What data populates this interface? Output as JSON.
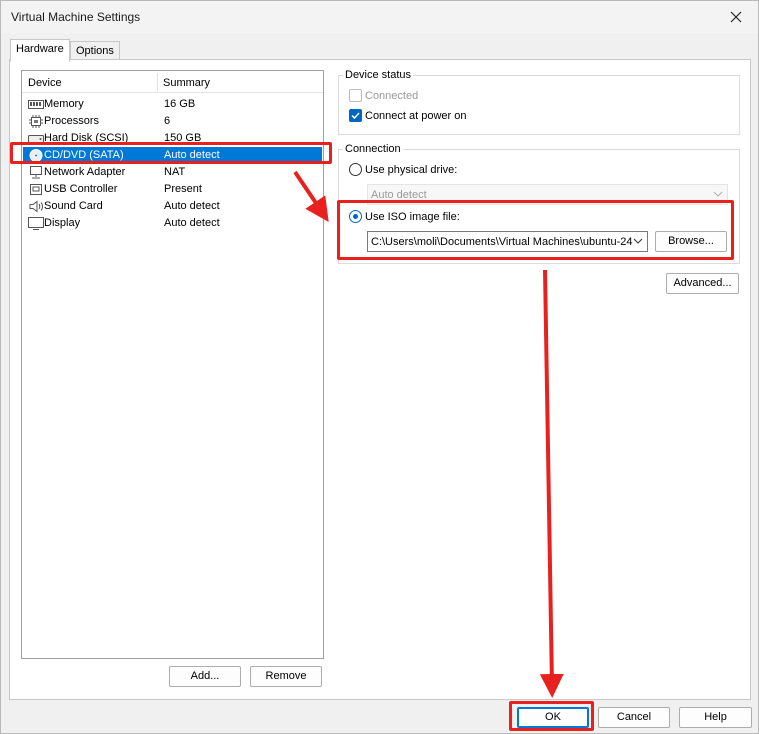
{
  "window": {
    "title": "Virtual Machine Settings",
    "close_glyph": "✕"
  },
  "tabs": [
    {
      "label": "Hardware"
    },
    {
      "label": "Options"
    }
  ],
  "device_list": {
    "columns": {
      "device": "Device",
      "summary": "Summary"
    },
    "rows": [
      {
        "name": "Memory",
        "summary": "16 GB",
        "icon": "memory-icon"
      },
      {
        "name": "Processors",
        "summary": "6",
        "icon": "processor-icon"
      },
      {
        "name": "Hard Disk (SCSI)",
        "summary": "150 GB",
        "icon": "hard-disk-icon"
      },
      {
        "name": "CD/DVD (SATA)",
        "summary": "Auto detect",
        "icon": "cd-dvd-icon",
        "selected": true
      },
      {
        "name": "Network Adapter",
        "summary": "NAT",
        "icon": "network-adapter-icon"
      },
      {
        "name": "USB Controller",
        "summary": "Present",
        "icon": "usb-icon"
      },
      {
        "name": "Sound Card",
        "summary": "Auto detect",
        "icon": "sound-card-icon"
      },
      {
        "name": "Display",
        "summary": "Auto detect",
        "icon": "display-icon"
      }
    ],
    "add_label": "Add...",
    "remove_label": "Remove"
  },
  "device_status": {
    "title": "Device status",
    "connected_label": "Connected",
    "connected_checked": false,
    "connect_at_power_on_label": "Connect at power on",
    "connect_at_power_on_checked": true
  },
  "connection": {
    "title": "Connection",
    "physical_drive_label": "Use physical drive:",
    "physical_drive_value": "Auto detect",
    "iso_label": "Use ISO image file:",
    "iso_path": "C:\\Users\\moli\\Documents\\Virtual Machines\\ubuntu-24",
    "browse_label": "Browse...",
    "selected": "iso"
  },
  "advanced_label": "Advanced...",
  "footer": {
    "ok_label": "OK",
    "cancel_label": "Cancel",
    "help_label": "Help"
  },
  "colors": {
    "selection": "#0078d7",
    "annotation": "#e8211f",
    "accent": "#0067c0"
  }
}
